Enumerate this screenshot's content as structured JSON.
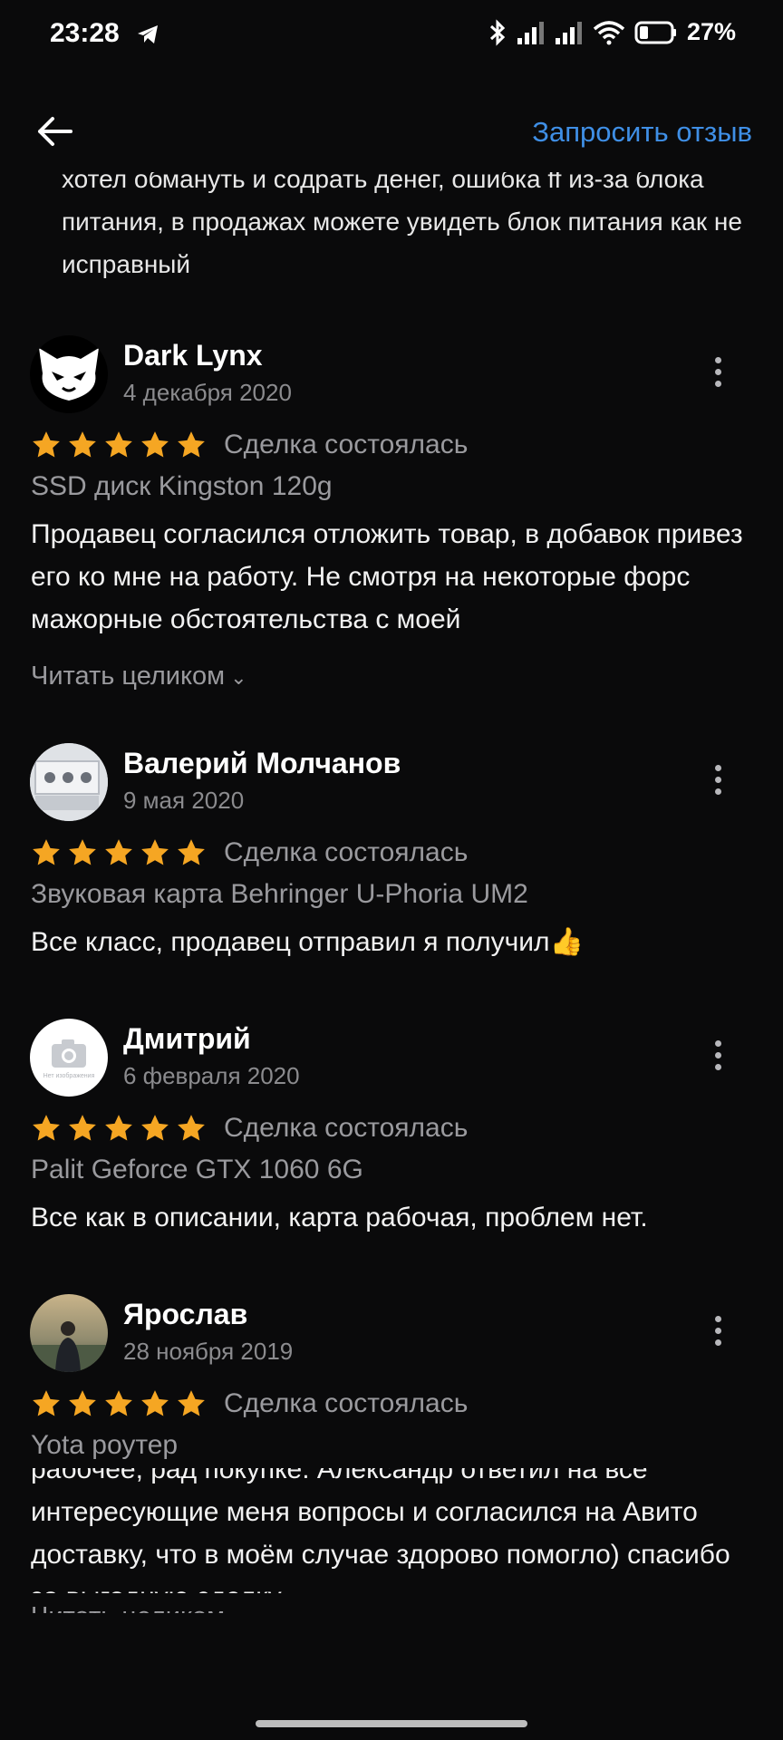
{
  "status_bar": {
    "time": "23:28",
    "battery": "27%",
    "icons": [
      "telegram-icon",
      "bluetooth-icon",
      "signal-icon",
      "signal-icon",
      "wifi-icon",
      "battery-icon"
    ]
  },
  "header": {
    "back_icon": "arrow-left-icon",
    "action_label": "Запросить отзыв",
    "accent": "#3f8fe6"
  },
  "previous_review": {
    "text": "хотел обмануть и содрать денег, ошибка ff из-за блока питания, в продажах можете увидеть блок питания как не исправный"
  },
  "star_color": "#f5a623",
  "reviews": [
    {
      "author": "Dark Lynx",
      "date": "4 декабря 2020",
      "stars": 5,
      "status": "Сделка состоялась",
      "product": "SSD диск Kingston 120g",
      "text": "Продавец согласился отложить товар, в добавок привез его ко мне на работу. Не смотря на некоторые форс мажорные обстоятельства с моей",
      "read_more": "Читать целиком"
    },
    {
      "author": "Валерий Молчанов",
      "date": "9 мая 2020",
      "stars": 5,
      "status": "Сделка состоялась",
      "product": "Звуковая карта Behringer U-Phoria UM2",
      "text": "Все класс, продавец отправил я получил👍"
    },
    {
      "author": "Дмитрий",
      "date": "6 февраля 2020",
      "stars": 5,
      "status": "Сделка состоялась",
      "product": "Palit Geforce GTX 1060 6G",
      "text": "Все как в описании, карта рабочая, проблем нет.",
      "avatar_caption": "Нет изображения"
    },
    {
      "author": "Ярослав",
      "date": "28 ноября 2019",
      "stars": 5,
      "status": "Сделка состоялась",
      "product": "Yota роутер",
      "text": "рабочее, рад покупке. Александр ответил на все интересующие меня вопросы и согласился на Авито доставку, что в моём случае здорово помогло) спасибо за выгодную сделку",
      "read_more": "Читать целиком"
    }
  ]
}
